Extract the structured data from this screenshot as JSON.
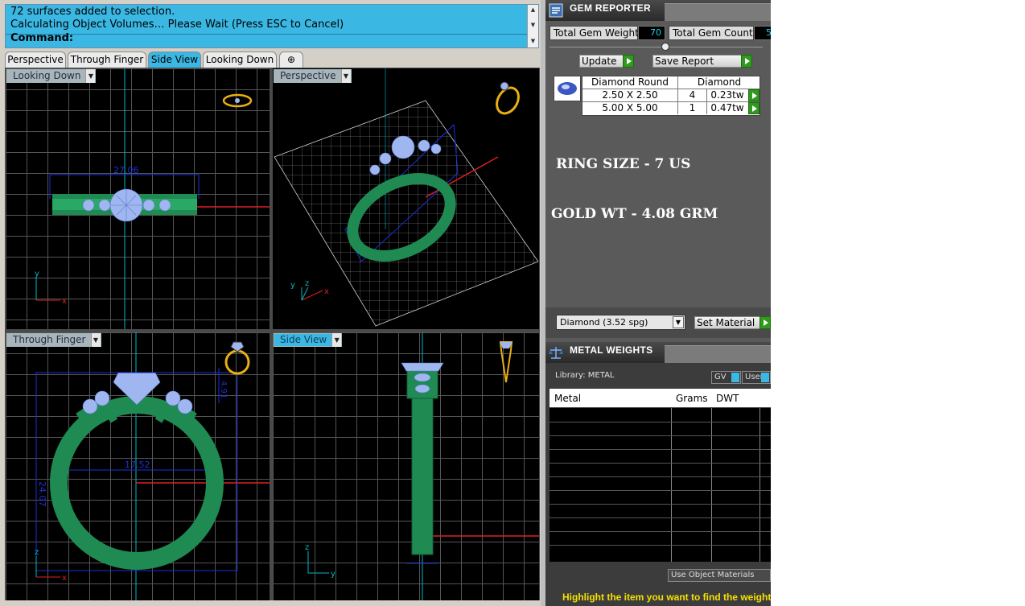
{
  "command": {
    "lines": [
      "72 surfaces added to selection.",
      "Calculating Object Volumes… Please Wait (Press ESC to Cancel)"
    ],
    "prompt": "Command:"
  },
  "tabs": [
    {
      "label": "Perspective",
      "active": false
    },
    {
      "label": "Through Finger",
      "active": false
    },
    {
      "label": "Side View",
      "active": true
    },
    {
      "label": "Looking Down",
      "active": false
    }
  ],
  "add_tab_symbol": "⊕",
  "viewports": {
    "looking_down": {
      "label": "Looking Down",
      "dimension": "27.06",
      "axes": {
        "v": "y",
        "h": "x"
      }
    },
    "perspective": {
      "label": "Perspective",
      "axes": {
        "v": "y",
        "v2": "z",
        "h": "x"
      }
    },
    "through_finger": {
      "label": "Through Finger",
      "dim_width": "17.52",
      "dim_height": "24.07",
      "dim_top": "4.91",
      "axes": {
        "v": "z",
        "h": "x"
      }
    },
    "side_view": {
      "label": "Side View",
      "axes": {
        "v": "z",
        "h": "y"
      }
    }
  },
  "gem_reporter": {
    "title": "GEM REPORTER",
    "total_weight_label": "Total Gem Weight",
    "total_weight_value": "70",
    "total_count_label": "Total Gem Count",
    "total_count_value": "5",
    "update_label": "Update",
    "save_label": "Save Report",
    "table": {
      "headers": [
        "Diamond Round",
        "Diamond"
      ],
      "rows": [
        {
          "size": "2.50 X 2.50",
          "count": "4",
          "weight": "0.23tw"
        },
        {
          "size": "5.00 X 5.00",
          "count": "1",
          "weight": "0.47tw"
        }
      ]
    },
    "ring_size": "RING SIZE - 7 US",
    "gold_wt": "GOLD WT - 4.08 GRM",
    "material_select": "Diamond      (3.52 spg)",
    "set_material_label": "Set Material"
  },
  "metal_weights": {
    "title": "METAL WEIGHTS",
    "library_label": "Library: METAL",
    "gv_label": "GV",
    "user_label": "User",
    "columns": [
      "Metal",
      "Grams",
      "DWT"
    ],
    "use_object_label": "Use Object Materials",
    "hint": "Highlight the item you want to find the weight"
  },
  "colors": {
    "accent": "#3bb7e3",
    "ring_green": "#1f8a52",
    "stone_blue": "#9fb6f0",
    "dimension_blue": "#1c2fd6",
    "axis_red": "#e02020",
    "axis_cyan": "#00b8c8",
    "hint_yellow": "#f5e000"
  }
}
